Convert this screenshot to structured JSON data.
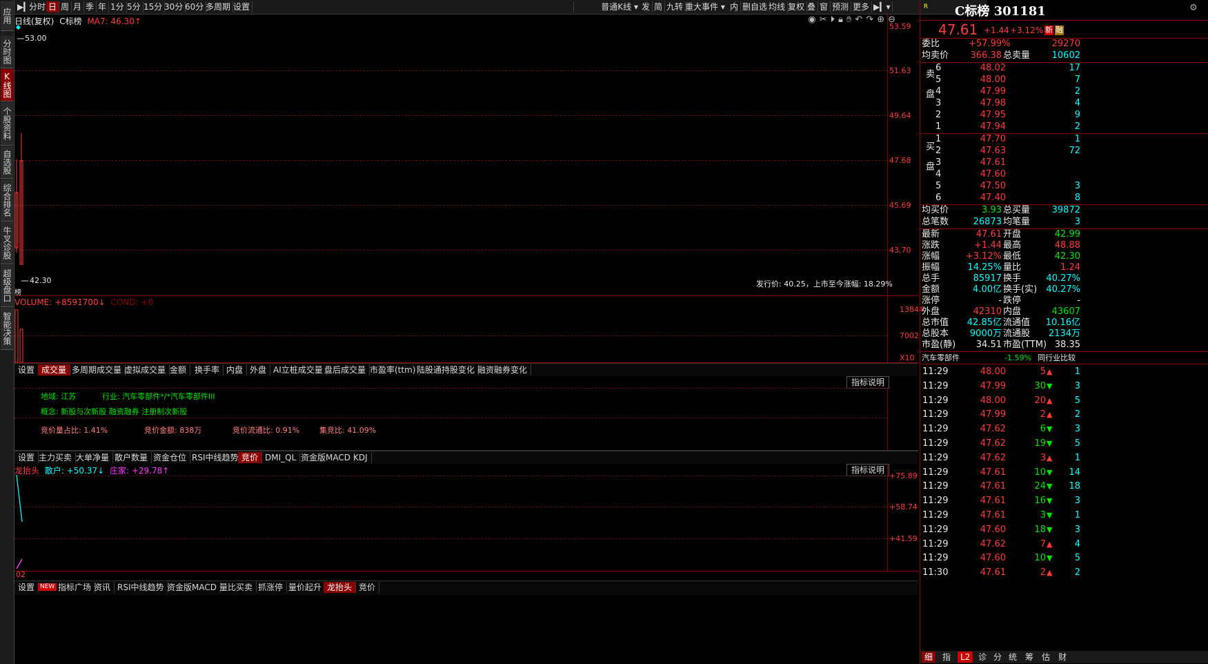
{
  "sidebar": {
    "tabs": [
      {
        "label": "应用",
        "active": false
      },
      {
        "label": "分时图",
        "active": false
      },
      {
        "label": "K线图",
        "active": true
      },
      {
        "label": "个股资料",
        "active": false
      },
      {
        "label": "自选股",
        "active": false
      },
      {
        "label": "综合排名",
        "active": false
      },
      {
        "label": "牛叉诊股",
        "active": false
      },
      {
        "label": "超级盘口",
        "active": false
      },
      {
        "label": "智能决策",
        "active": false
      }
    ]
  },
  "toolbar": {
    "left_items": [
      "分时",
      "日",
      "周",
      "月",
      "季",
      "年",
      "1分",
      "5分",
      "15分",
      "30分",
      "60分",
      "多周期",
      "设置"
    ],
    "active_item": "日",
    "kline_type": "普通K线",
    "right_items": [
      "发",
      "简",
      "九转",
      "重大事件",
      "内",
      "删自选",
      "均线",
      "复权",
      "叠",
      "窗",
      "预测",
      "更多"
    ]
  },
  "kline": {
    "title": "日线(复权)",
    "name": "C标榜",
    "ma_label": "MA7: 46.30↑",
    "y_ticks": [
      "53.59",
      "51.63",
      "49.64",
      "47.68",
      "45.69",
      "43.70"
    ],
    "high_marker": "53.00",
    "low_marker": "42.30",
    "bottom_char": "榜",
    "issue_note": "发行价: 40.25，上市至今涨幅: 18.29%"
  },
  "volume": {
    "label": "VOLUME: +8591700↓",
    "cond": "COND: +0",
    "y_ticks": [
      "13844",
      "7002"
    ],
    "unit": "X10"
  },
  "info_tabs": {
    "items": [
      "设置",
      "成交量",
      "多周期成交量",
      "虚拟成交量",
      "金额",
      "换手率",
      "内盘",
      "外盘",
      "AI立桩成交量",
      "盘后成交量",
      "市盈率(ttm)",
      "陆股通持股变化",
      "融资融券变化"
    ],
    "active": "成交量"
  },
  "info": {
    "explain_btn": "指标说明",
    "region": "地域: 江苏",
    "industry": "行业: 汽车零部件*/*汽车零部件III",
    "concept": "概念: 新股与次新股  融资融券  注册制次新股",
    "bid_ratio": "竞价量占比: 1.41%",
    "bid_amount": "竞价金额: 838万",
    "bid_float": "竞价流通比: 0.91%",
    "bid_focus": "集竞比: 41.09%"
  },
  "ind_tabs": {
    "items": [
      "设置",
      "主力买卖",
      "大单净量",
      "散户数量",
      "资金仓位",
      "RSI中线趋势",
      "竞价",
      "DMI_QL",
      "资金版MACD",
      "KDJ"
    ],
    "active": "竞价"
  },
  "indicator": {
    "name": "龙抬头",
    "retail": "散户: +50.37↓",
    "dealer": "庄家: +29.78↑",
    "explain_btn": "指标说明",
    "y_ticks": [
      "+75.89",
      "+58.74",
      "+41.59"
    ],
    "x_label": "02"
  },
  "bottom_tabs": {
    "items": [
      "设置",
      "NEW",
      "指标广场",
      "资讯",
      "RSI中线趋势",
      "资金版MACD",
      "量比买卖",
      "抓涨停",
      "量价起升",
      "龙抬头",
      "竞价"
    ],
    "active": "龙抬头"
  },
  "quote": {
    "badge": "R",
    "title": "C标榜 301181",
    "price": "47.61",
    "change": "+1.44",
    "change_pct": "+3.12%",
    "tag": "新",
    "tag2": "融",
    "weibi_label": "委比",
    "weibi": "+57.99%",
    "weicha": "29270",
    "avg_sell_label": "均卖价",
    "avg_sell": "366.38",
    "total_sell_label": "总卖量",
    "total_sell": "10602",
    "sell_side": "卖盘",
    "asks": [
      {
        "lvl": "6",
        "price": "48.02",
        "vol": "17"
      },
      {
        "lvl": "5",
        "price": "48.00",
        "vol": "7"
      },
      {
        "lvl": "4",
        "price": "47.99",
        "vol": "2"
      },
      {
        "lvl": "3",
        "price": "47.98",
        "vol": "4"
      },
      {
        "lvl": "2",
        "price": "47.95",
        "vol": "9"
      },
      {
        "lvl": "1",
        "price": "47.94",
        "vol": "2"
      }
    ],
    "buy_side": "买盘",
    "bids": [
      {
        "lvl": "1",
        "price": "47.70",
        "vol": "1"
      },
      {
        "lvl": "2",
        "price": "47.63",
        "vol": "72"
      },
      {
        "lvl": "3",
        "price": "47.61",
        "vol": ""
      },
      {
        "lvl": "4",
        "price": "47.60",
        "vol": ""
      },
      {
        "lvl": "5",
        "price": "47.50",
        "vol": "3"
      },
      {
        "lvl": "6",
        "price": "47.40",
        "vol": "8"
      }
    ],
    "avg_buy_label": "均买价",
    "avg_buy": "3.93",
    "total_buy_label": "总买量",
    "total_buy": "39872",
    "total_trades_label": "总笔数",
    "total_trades": "26873",
    "avg_trade_label": "均笔量",
    "avg_trade": "3",
    "stats": [
      {
        "l1": "最新",
        "v1": "47.61",
        "c1": "red",
        "l2": "开盘",
        "v2": "42.99",
        "c2": "grn"
      },
      {
        "l1": "涨跌",
        "v1": "+1.44",
        "c1": "red",
        "l2": "最高",
        "v2": "48.88",
        "c2": "red"
      },
      {
        "l1": "涨幅",
        "v1": "+3.12%",
        "c1": "red",
        "l2": "最低",
        "v2": "42.30",
        "c2": "grn"
      },
      {
        "l1": "振幅",
        "v1": "14.25%",
        "c1": "cyan",
        "l2": "量比",
        "v2": "1.24",
        "c2": "red"
      },
      {
        "l1": "总手",
        "v1": "85917",
        "c1": "cyan",
        "l2": "换手",
        "v2": "40.27%",
        "c2": "cyan"
      },
      {
        "l1": "金额",
        "v1": "4.00亿",
        "c1": "cyan",
        "l2": "换手(实)",
        "v2": "40.27%",
        "c2": "cyan"
      },
      {
        "l1": "涨停",
        "v1": "-",
        "c1": "wht",
        "l2": "跌停",
        "v2": "-",
        "c2": "wht"
      },
      {
        "l1": "外盘",
        "v1": "42310",
        "c1": "red",
        "l2": "内盘",
        "v2": "43607",
        "c2": "grn"
      },
      {
        "l1": "总市值",
        "v1": "42.85亿",
        "c1": "cyan",
        "l2": "流通值",
        "v2": "10.16亿",
        "c2": "cyan"
      },
      {
        "l1": "总股本",
        "v1": "9000万",
        "c1": "cyan",
        "l2": "流通股",
        "v2": "2134万",
        "c2": "cyan"
      },
      {
        "l1": "市盈(静)",
        "v1": "34.51",
        "c1": "wht",
        "l2": "市盈(TTM)",
        "v2": "38.35",
        "c2": "wht"
      }
    ],
    "sector": "汽车零部件",
    "sector_pct": "-1.59%",
    "peer_btn": "同行业比较",
    "ticks": [
      {
        "t": "11:29",
        "p": "48.00",
        "pc": "red",
        "v": "5",
        "dir": "up",
        "n": "1"
      },
      {
        "t": "11:29",
        "p": "47.99",
        "pc": "red",
        "v": "30",
        "dir": "down",
        "n": "3"
      },
      {
        "t": "11:29",
        "p": "48.00",
        "pc": "red",
        "v": "20",
        "dir": "up",
        "n": "5"
      },
      {
        "t": "11:29",
        "p": "47.99",
        "pc": "red",
        "v": "2",
        "dir": "up",
        "n": "2"
      },
      {
        "t": "11:29",
        "p": "47.62",
        "pc": "red",
        "v": "6",
        "dir": "down",
        "n": "3"
      },
      {
        "t": "11:29",
        "p": "47.62",
        "pc": "red",
        "v": "19",
        "dir": "down",
        "n": "5"
      },
      {
        "t": "11:29",
        "p": "47.62",
        "pc": "red",
        "v": "3",
        "dir": "up",
        "n": "1"
      },
      {
        "t": "11:29",
        "p": "47.61",
        "pc": "red",
        "v": "10",
        "dir": "down",
        "n": "14"
      },
      {
        "t": "11:29",
        "p": "47.61",
        "pc": "red",
        "v": "24",
        "dir": "down",
        "n": "18"
      },
      {
        "t": "11:29",
        "p": "47.61",
        "pc": "red",
        "v": "16",
        "dir": "down",
        "n": "3"
      },
      {
        "t": "11:29",
        "p": "47.61",
        "pc": "red",
        "v": "3",
        "dir": "down",
        "n": "1"
      },
      {
        "t": "11:29",
        "p": "47.60",
        "pc": "red",
        "v": "18",
        "dir": "down",
        "n": "3"
      },
      {
        "t": "11:29",
        "p": "47.62",
        "pc": "red",
        "v": "7",
        "dir": "up",
        "n": "4"
      },
      {
        "t": "11:29",
        "p": "47.60",
        "pc": "red",
        "v": "10",
        "dir": "down",
        "n": "5"
      },
      {
        "t": "11:30",
        "p": "47.61",
        "pc": "red",
        "v": "2",
        "dir": "up",
        "n": "2"
      }
    ],
    "bottom_tabs": [
      "细",
      "指",
      "L2",
      "诊",
      "分",
      "统",
      "筹",
      "估",
      "财"
    ],
    "bottom_active": "L2"
  }
}
